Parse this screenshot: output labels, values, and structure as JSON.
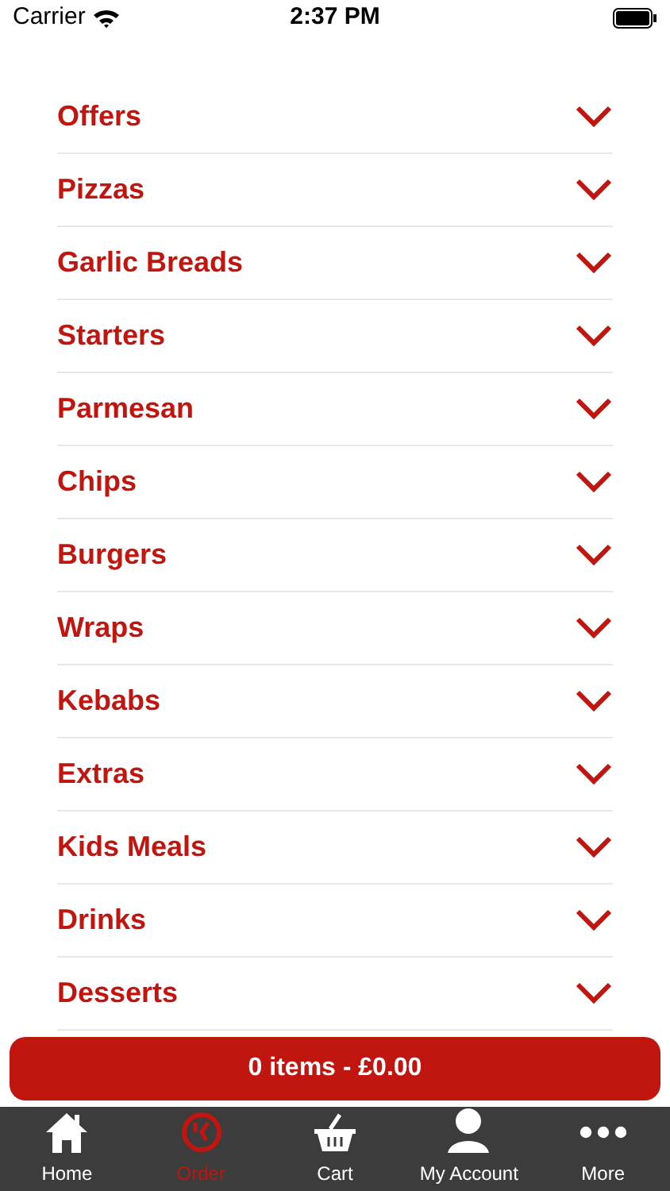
{
  "status_bar": {
    "carrier": "Carrier",
    "time": "2:37 PM"
  },
  "categories": [
    {
      "label": "Offers",
      "expanded": false
    },
    {
      "label": "Pizzas",
      "expanded": false
    },
    {
      "label": "Garlic Breads",
      "expanded": false
    },
    {
      "label": "Starters",
      "expanded": false
    },
    {
      "label": "Parmesan",
      "expanded": false
    },
    {
      "label": "Chips",
      "expanded": false
    },
    {
      "label": "Burgers",
      "expanded": false
    },
    {
      "label": "Wraps",
      "expanded": false
    },
    {
      "label": "Kebabs",
      "expanded": false
    },
    {
      "label": "Extras",
      "expanded": false
    },
    {
      "label": "Kids Meals",
      "expanded": false
    },
    {
      "label": "Drinks",
      "expanded": false
    },
    {
      "label": "Desserts",
      "expanded": false
    }
  ],
  "cart_button": "0 items - £0.00",
  "tab_bar": [
    {
      "label": "Home",
      "kind": "home",
      "selected": false
    },
    {
      "label": "Order",
      "kind": "order",
      "selected": true
    },
    {
      "label": "Cart",
      "kind": "cart",
      "selected": false
    },
    {
      "label": "My Account",
      "kind": "account",
      "selected": false
    },
    {
      "label": "More",
      "kind": "more",
      "selected": false
    }
  ]
}
